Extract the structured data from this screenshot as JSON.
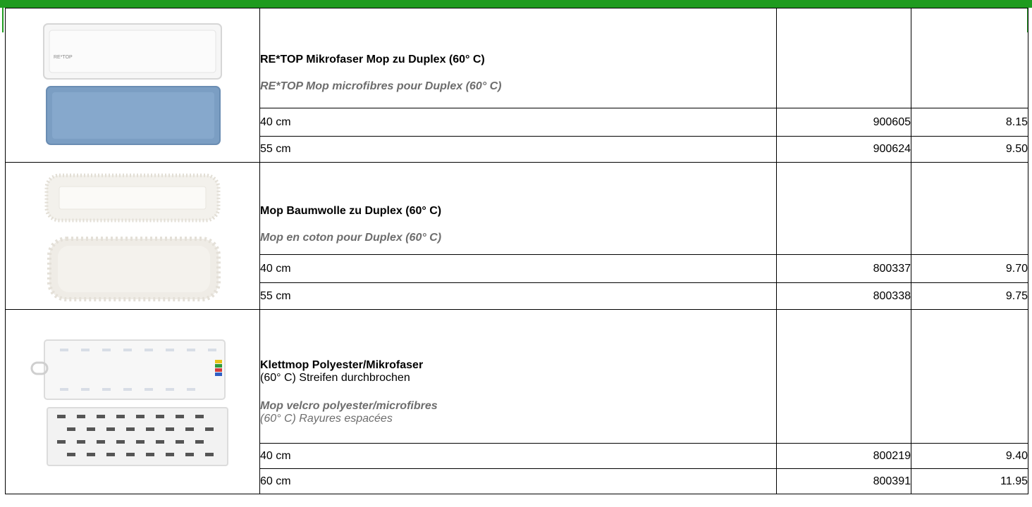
{
  "colors": {
    "accent_green": "#1f9b1f",
    "french_text": "#6d6d6d"
  },
  "products": [
    {
      "image_icon": "microfiber-mop-photo",
      "title_de": "RE*TOP Mikrofaser Mop zu Duplex (60° C)",
      "subtitle_de": "",
      "title_fr": "RE*TOP Mop microfibres pour Duplex (60° C)",
      "subtitle_fr": "",
      "logo_text": "RE*TOP",
      "variants": [
        {
          "size": "40 cm",
          "article": "900605",
          "price": "8.15"
        },
        {
          "size": "55 cm",
          "article": "900624",
          "price": "9.50"
        }
      ]
    },
    {
      "image_icon": "cotton-mop-photo",
      "title_de": "Mop Baumwolle zu Duplex (60° C)",
      "subtitle_de": "",
      "title_fr": "Mop en coton pour Duplex (60° C)",
      "subtitle_fr": "",
      "variants": [
        {
          "size": "40 cm",
          "article": "800337",
          "price": "9.70"
        },
        {
          "size": "55 cm",
          "article": "800338",
          "price": "9.75"
        }
      ]
    },
    {
      "image_icon": "velcro-mop-photo",
      "title_de": "Klettmop Polyester/Mikrofaser",
      "subtitle_de": "(60° C) Streifen durchbrochen",
      "title_fr": "Mop velcro polyester/microfibres",
      "subtitle_fr": "(60° C) Rayures espacées",
      "variants": [
        {
          "size": "40 cm",
          "article": "800219",
          "price": "9.40"
        },
        {
          "size": "60 cm",
          "article": "800391",
          "price": "11.95"
        }
      ]
    }
  ]
}
